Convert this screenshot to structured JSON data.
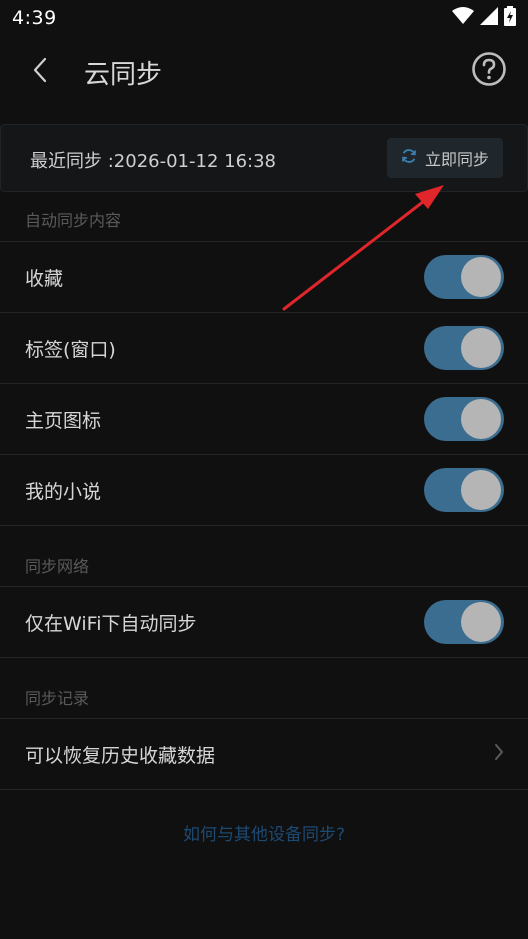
{
  "status_bar": {
    "time": "4:39",
    "icons": [
      "wifi-icon",
      "signal-icon",
      "battery-icon"
    ]
  },
  "app_bar": {
    "title": "云同步",
    "back_icon": "chevron-left-icon",
    "help_icon": "help-circle-icon"
  },
  "sync_card": {
    "last_sync": "最近同步 :2026-01-12 16:38",
    "sync_now_label": "立即同步",
    "sync_icon": "refresh-icon"
  },
  "sections": {
    "auto_sync_content": "自动同步内容",
    "sync_network": "同步网络",
    "sync_records": "同步记录"
  },
  "auto_sync_items": [
    {
      "label": "收藏",
      "enabled": true
    },
    {
      "label": "标签(窗口)",
      "enabled": true
    },
    {
      "label": "主页图标",
      "enabled": true
    },
    {
      "label": "我的小说",
      "enabled": true
    }
  ],
  "network_items": [
    {
      "label": "仅在WiFi下自动同步",
      "enabled": true
    }
  ],
  "records_items": [
    {
      "label": "可以恢复历史收藏数据"
    }
  ],
  "help_link": "如何与其他设备同步?",
  "colors": {
    "background": "#101010",
    "toggle_on": "#3a6d90",
    "link": "#1d4a73",
    "annotation_arrow": "#e0262a"
  }
}
